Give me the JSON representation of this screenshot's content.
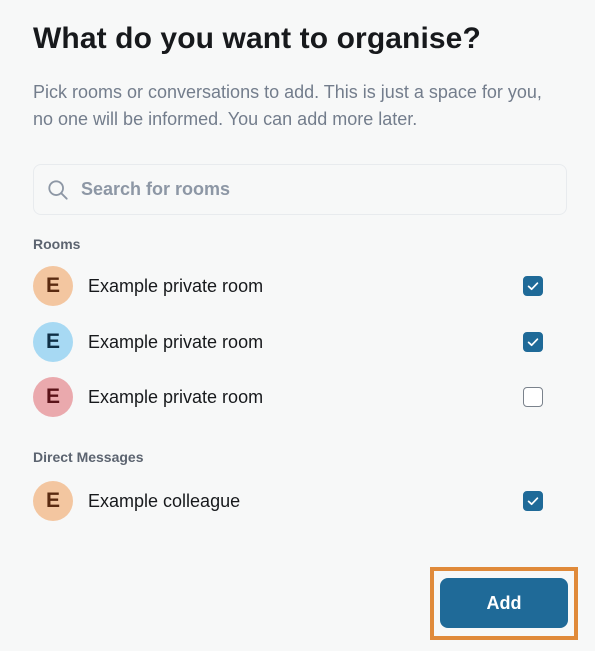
{
  "dialog": {
    "title": "What do you want to organise?",
    "subtitle": "Pick rooms or conversations to add. This is just a space for you, no one will be informed. You can add more later."
  },
  "search": {
    "placeholder": "Search for rooms",
    "value": "",
    "icon": "search-icon"
  },
  "rooms": {
    "label": "Rooms",
    "items": [
      {
        "initial": "E",
        "name": "Example private room",
        "checked": true,
        "avatar_bg": "#f3c6a0",
        "avatar_fg": "#5a2a10"
      },
      {
        "initial": "E",
        "name": "Example private room",
        "checked": true,
        "avatar_bg": "#a7d9f3",
        "avatar_fg": "#0f2f45"
      },
      {
        "initial": "E",
        "name": "Example private room",
        "checked": false,
        "avatar_bg": "#eaa9ad",
        "avatar_fg": "#5a1218"
      }
    ]
  },
  "direct_messages": {
    "label": "Direct Messages",
    "items": [
      {
        "initial": "E",
        "name": "Example colleague",
        "checked": true,
        "avatar_bg": "#f3c6a0",
        "avatar_fg": "#5a2a10"
      }
    ]
  },
  "actions": {
    "add_label": "Add"
  },
  "colors": {
    "accent": "#1f6a98",
    "highlight": "#e08a3a",
    "muted_text": "#737d8c"
  }
}
